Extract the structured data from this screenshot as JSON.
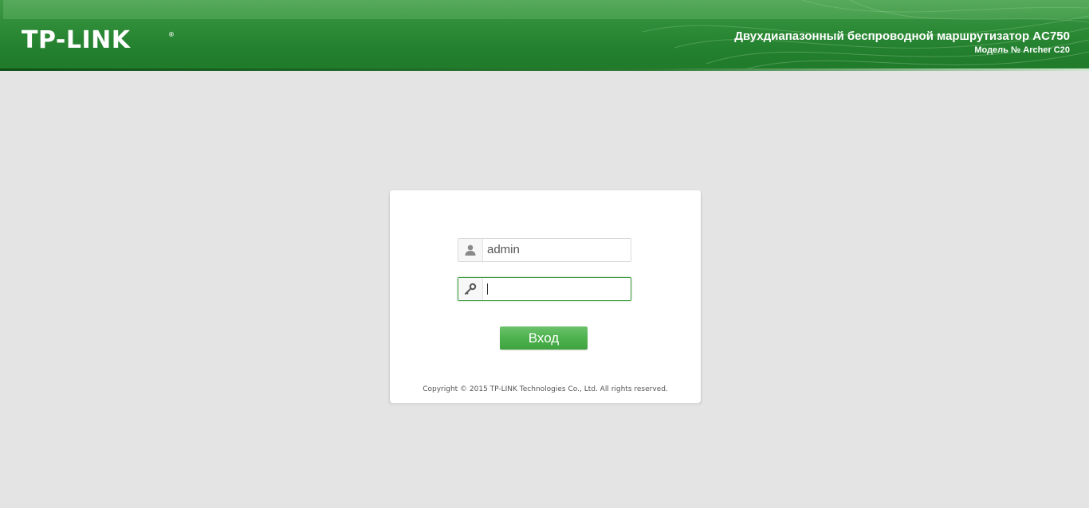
{
  "header": {
    "logo_text": "TP-LINK",
    "logo_registered": "®",
    "product_title": "Двухдиапазонный беспроводной маршрутизатор AC750",
    "product_model": "Модель № Archer C20"
  },
  "login": {
    "username": {
      "icon": "user-icon",
      "value": "admin"
    },
    "password": {
      "icon": "key-icon",
      "value": ""
    },
    "submit_label": "Вход",
    "copyright": "Copyright © 2015 TP-LINK Technologies Co., Ltd. All rights reserved."
  },
  "colors": {
    "brand_green": "#2f8c38",
    "button_green": "#4db24d",
    "focus_border": "#3f9b3f",
    "page_background": "#e4e4e4"
  }
}
